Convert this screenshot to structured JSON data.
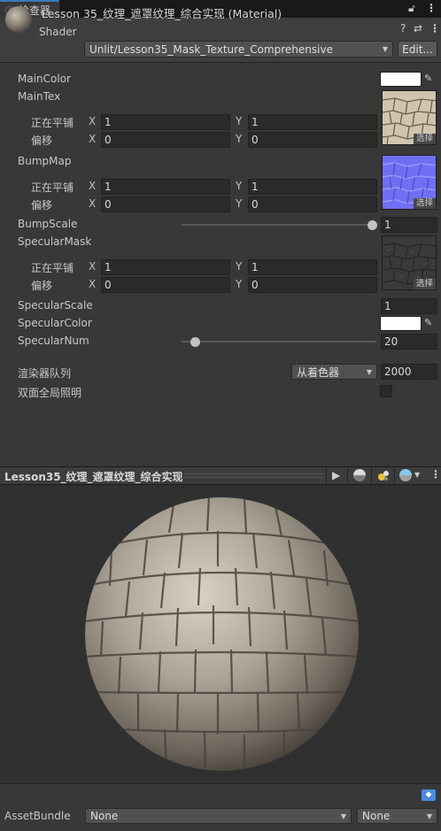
{
  "tab": {
    "icon": "inspector-icon",
    "label": "检查器"
  },
  "toolbar": {
    "lock_icon": "lock-icon",
    "menu_icon": "kebab-menu-icon"
  },
  "header": {
    "title": "Lesson 35_纹理_遮罩纹理_综合实现 (Material)",
    "shader_label": "Shader",
    "shader_value": "Unlit/Lesson35_Mask_Texture_Comprehensive",
    "edit_button": "Edit...",
    "help_icon": "help-icon",
    "preset_icon": "preset-icon",
    "menu_icon": "kebab-menu-icon"
  },
  "properties": {
    "main_color": {
      "label": "MainColor",
      "color": "#ffffff"
    },
    "main_tex": {
      "label": "MainTex",
      "tiling_label": "正在平铺",
      "tiling_x": "1",
      "tiling_y": "1",
      "offset_label": "偏移",
      "offset_x": "0",
      "offset_y": "0",
      "select": "选择"
    },
    "bump_map": {
      "label": "BumpMap",
      "tiling_label": "正在平铺",
      "tiling_x": "1",
      "tiling_y": "1",
      "offset_label": "偏移",
      "offset_x": "0",
      "offset_y": "0",
      "select": "选择"
    },
    "bump_scale": {
      "label": "BumpScale",
      "value": "1",
      "slider_fraction": 1.0
    },
    "specular_mask": {
      "label": "SpecularMask",
      "tiling_label": "正在平铺",
      "tiling_x": "1",
      "tiling_y": "1",
      "offset_label": "偏移",
      "offset_x": "0",
      "offset_y": "0",
      "select": "选择"
    },
    "specular_scale": {
      "label": "SpecularScale",
      "value": "1"
    },
    "specular_color": {
      "label": "SpecularColor",
      "color": "#ffffff"
    },
    "specular_num": {
      "label": "SpecularNum",
      "value": "20",
      "slider_fraction": 0.07
    },
    "axis_x": "X",
    "axis_y": "Y",
    "render_queue": {
      "label": "渲染器队列",
      "mode": "从着色器",
      "value": "2000"
    },
    "double_sided_gi": {
      "label": "双面全局照明",
      "checked": false
    }
  },
  "preview": {
    "title": "Lesson35_纹理_遮罩纹理_综合实现",
    "play_icon": "play-icon",
    "sphere_icon": "sphere-mesh-icon",
    "light_icon": "light-icon",
    "background_icon": "preview-background-icon",
    "menu_icon": "kebab-menu-icon"
  },
  "asset_bundle": {
    "label": "AssetBundle",
    "name_value": "None",
    "variant_value": "None",
    "tag_icon": "asset-label-icon"
  },
  "colors": {
    "accent": "#3a79bb",
    "panel": "#383838",
    "field": "#2a2a2a"
  }
}
